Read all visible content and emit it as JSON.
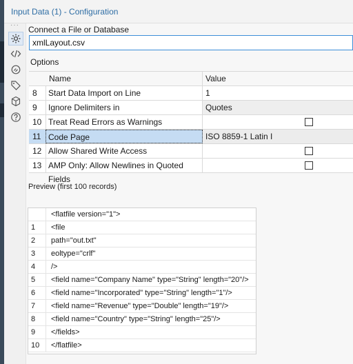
{
  "window": {
    "title": "Input Data (1) - Configuration"
  },
  "tools": [
    {
      "icon": "gear-icon"
    },
    {
      "icon": "code-icon"
    },
    {
      "icon": "connection-icon"
    },
    {
      "icon": "tag-icon"
    },
    {
      "icon": "cube-icon"
    },
    {
      "icon": "help-icon"
    }
  ],
  "connect": {
    "label": "Connect a File or Database",
    "value": "xmlLayout.csv"
  },
  "options": {
    "label": "Options",
    "headers": {
      "name": "Name",
      "value": "Value"
    },
    "rows": [
      {
        "num": "8",
        "name": "Start Data Import on Line",
        "value": "1"
      },
      {
        "num": "9",
        "name": "Ignore Delimiters in",
        "value": "Quotes"
      },
      {
        "num": "10",
        "name": "Treat Read Errors as Warnings",
        "value": "",
        "checked": false
      },
      {
        "num": "11",
        "name": "Code Page",
        "value": "ISO 8859-1 Latin I",
        "selected": true
      },
      {
        "num": "12",
        "name": "Allow Shared Write Access",
        "value": "",
        "checked": false
      },
      {
        "num": "13",
        "name": "AMP Only: Allow Newlines in Quoted Fields",
        "value": "",
        "checked": false
      }
    ]
  },
  "preview": {
    "label": "Preview (first 100 records)",
    "rows": [
      {
        "num": "",
        "text": "<flatfile version=\"1\">"
      },
      {
        "num": "1",
        "text": "<file"
      },
      {
        "num": "2",
        "text": "path=\"out.txt\""
      },
      {
        "num": "3",
        "text": "eoltype=\"crlf\""
      },
      {
        "num": "4",
        "text": "/>"
      },
      {
        "num": "5",
        "text": "<field name=\"Company Name\" type=\"String\" length=\"20\"/>"
      },
      {
        "num": "6",
        "text": "<field name=\"Incorporated\" type=\"String\" length=\"1\"/>"
      },
      {
        "num": "7",
        "text": "<field name=\"Revenue\" type=\"Double\" length=\"19\"/>"
      },
      {
        "num": "8",
        "text": "<field name=\"Country\" type=\"String\" length=\"25\"/>"
      },
      {
        "num": "9",
        "text": "</fields>"
      },
      {
        "num": "10",
        "text": "</flatfile>"
      }
    ]
  }
}
